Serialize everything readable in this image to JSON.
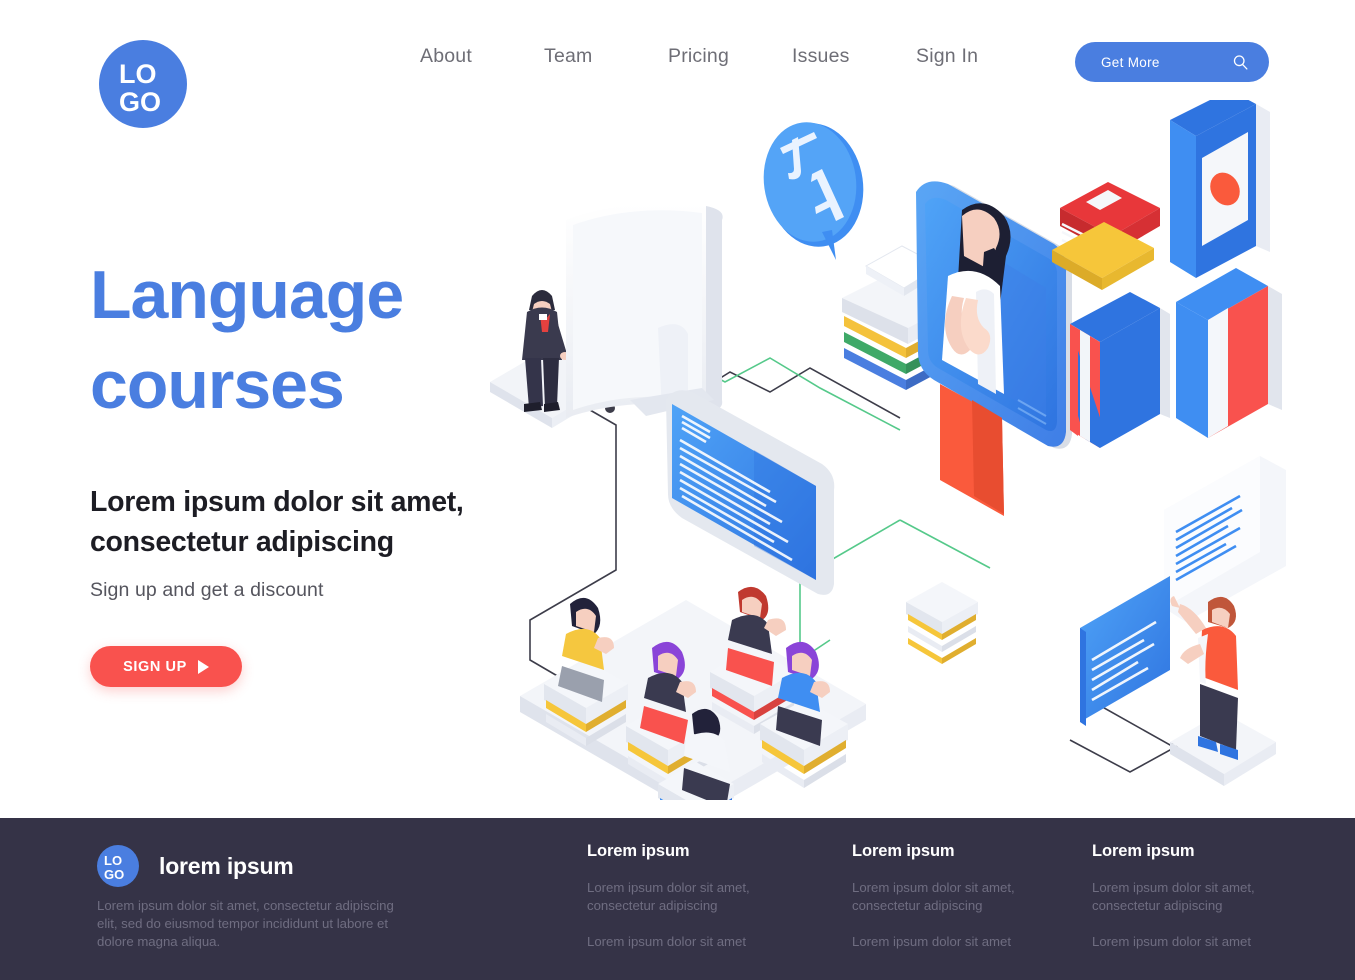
{
  "header": {
    "logo_text_top": "LO",
    "logo_text_bottom": "GO",
    "nav": [
      {
        "label": "About"
      },
      {
        "label": "Team"
      },
      {
        "label": "Pricing"
      },
      {
        "label": "Issues"
      },
      {
        "label": "Sign In"
      }
    ],
    "cta": {
      "label": "Get More",
      "icon": "search-icon"
    }
  },
  "hero": {
    "title_line1": "Language",
    "title_line2": "courses",
    "subtitle": "Lorem ipsum dolor sit amet, consectetur adipiscing",
    "note": "Sign up and get a discount",
    "button": {
      "label": "SIGN UP",
      "icon": "play-icon"
    }
  },
  "illustration": {
    "speech_bubble": {
      "glyph_left": "あ",
      "glyph_right": "A"
    },
    "scene_items": [
      "businessman-figure",
      "white-monitor",
      "blue-text-screen",
      "students-on-books-platform",
      "teacher-phone",
      "language-books-stack",
      "japanese-flag-book",
      "uk-flag-book",
      "france-flag-book",
      "paper-stack",
      "white-text-card",
      "blue-text-card",
      "pointing-person-figure"
    ]
  },
  "footer": {
    "logo_text_top": "LO",
    "logo_text_bottom": "GO",
    "brand": "lorem ipsum",
    "description": "Lorem ipsum dolor sit amet, consectetur adipiscing elit, sed do eiusmod tempor incididunt ut labore et dolore magna aliqua.",
    "columns": [
      {
        "title": "Lorem ipsum",
        "links": [
          "Lorem ipsum dolor sit amet, consectetur adipiscing",
          "Lorem ipsum dolor sit amet"
        ]
      },
      {
        "title": "Lorem ipsum",
        "links": [
          "Lorem ipsum dolor sit amet, consectetur adipiscing",
          "Lorem ipsum dolor sit amet"
        ]
      },
      {
        "title": "Lorem ipsum",
        "links": [
          "Lorem ipsum dolor sit amet, consectetur adipiscing",
          "Lorem ipsum dolor sit amet"
        ]
      }
    ]
  },
  "colors": {
    "brand_blue": "#4a7ee0",
    "accent_red": "#f9524e",
    "footer_bg": "#353347",
    "nav_text": "#6e6e76",
    "heading_dark": "#1d1d24"
  }
}
